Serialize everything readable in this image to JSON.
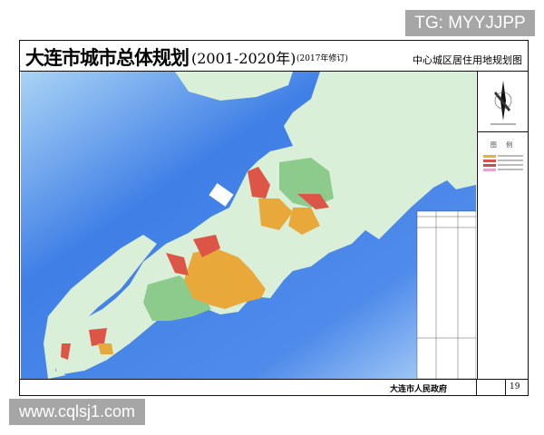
{
  "watermarks": {
    "top": "TG: MYYJJPP",
    "bottom": "www.cqlsj1.com"
  },
  "header": {
    "title": "大连市城市总体规划",
    "years": "(2001-2020年)",
    "revision": "(2017年修订)",
    "subtitle": "中心城区居住用地规划图"
  },
  "legend": {
    "title": "图 例",
    "swatch_colors": [
      "#e8b13a",
      "#d9534a",
      "#c0504d",
      "#e6a3d0"
    ]
  },
  "map_colors": {
    "sea": "#4a86e8",
    "land": "#d9efd8",
    "green": "#8ccb8c",
    "residential_existing": "#e9a93a",
    "residential_planned": "#dc5546"
  },
  "footer": {
    "organization": "大连市人民政府",
    "page": "19"
  }
}
